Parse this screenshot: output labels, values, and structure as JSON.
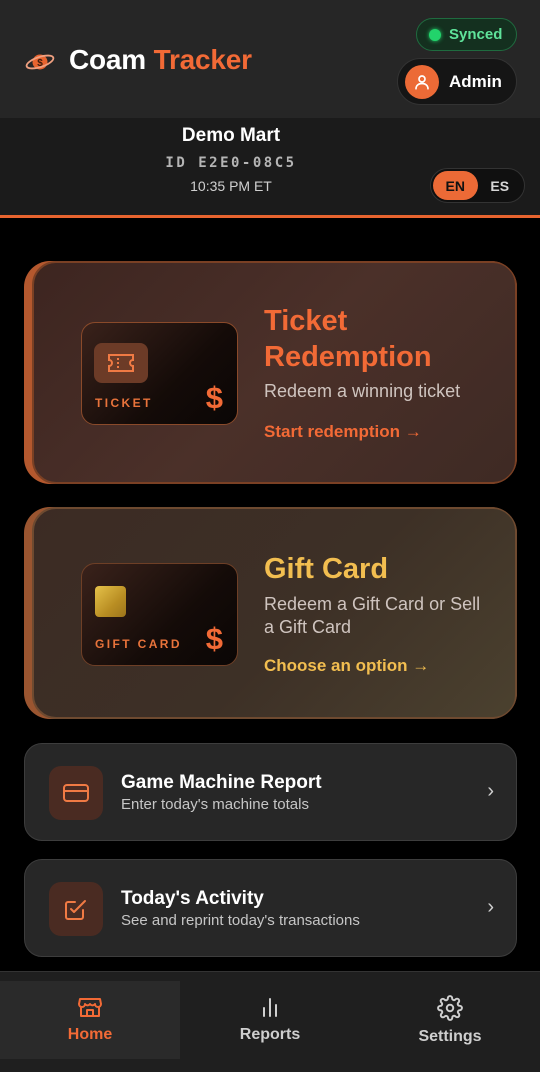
{
  "header": {
    "brand_part1": "Coam",
    "brand_part2": "Tracker",
    "sync_status": "Synced",
    "user_label": "Admin"
  },
  "store": {
    "name": "Demo Mart",
    "id": "ID E2E0-08C5",
    "time": "10:35 PM ET"
  },
  "language": {
    "options": [
      "EN",
      "ES"
    ],
    "selected": "EN"
  },
  "cards": {
    "ticket": {
      "mini_label": "TICKET",
      "currency": "$",
      "title_line1": "Ticket",
      "title_line2": "Redemption",
      "subtitle": "Redeem a winning ticket",
      "cta": "Start redemption →"
    },
    "gift": {
      "mini_label": "GIFT CARD",
      "currency": "$",
      "title": "Gift Card",
      "subtitle": "Redeem a Gift Card or Sell a Gift Card",
      "cta": "Choose an option →"
    }
  },
  "rows": [
    {
      "title": "Game Machine Report",
      "subtitle": "Enter today's machine totals",
      "icon": "credit-card-icon"
    },
    {
      "title": "Today's Activity",
      "subtitle": "See and reprint today's transactions",
      "icon": "checkbox-edit-icon"
    }
  ],
  "nav": [
    {
      "label": "Home",
      "icon": "store-icon",
      "active": true
    },
    {
      "label": "Reports",
      "icon": "bar-chart-icon",
      "active": false
    },
    {
      "label": "Settings",
      "icon": "gear-icon",
      "active": false
    }
  ],
  "colors": {
    "accent": "#f26a36",
    "gold": "#f2be50",
    "synced_green": "#22d36b"
  }
}
